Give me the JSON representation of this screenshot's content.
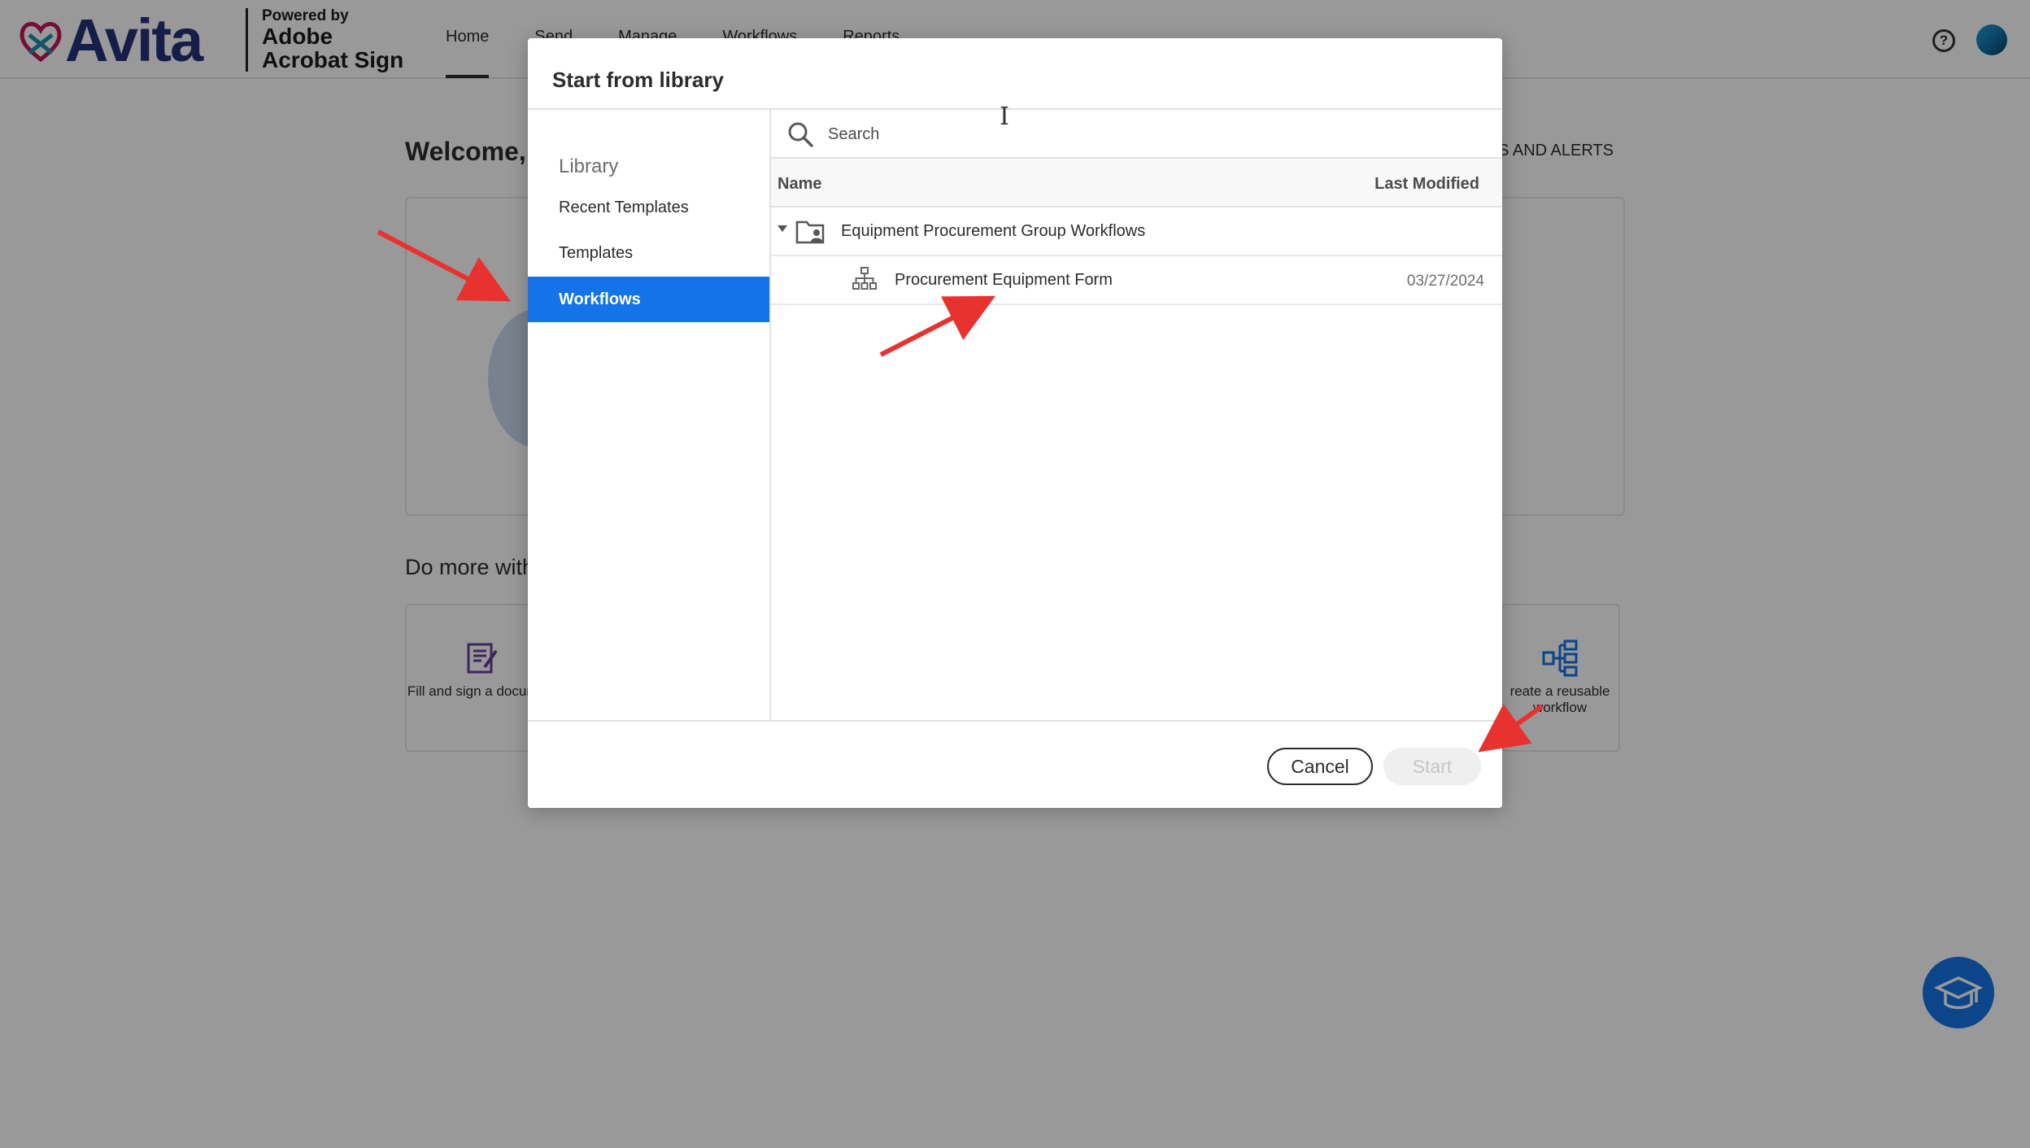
{
  "app": {
    "brand_name": "Avita",
    "powered_line1": "Powered by",
    "powered_line2": "Adobe",
    "powered_line3": "Acrobat Sign",
    "nav": [
      "Home",
      "Send",
      "Manage",
      "Workflows",
      "Reports"
    ],
    "active_nav": "Home",
    "help_icon_glyph": "?",
    "welcome": "Welcome, I",
    "alerts_link": "TS AND ALERTS",
    "do_more": "Do more with",
    "task_fill_sign": "Fill and sign a document",
    "task_reusable": "reate a reusable workflow",
    "accent_color": "#1473e6"
  },
  "modal": {
    "title": "Start from library",
    "sidebar": {
      "heading": "Library",
      "items": [
        "Recent Templates",
        "Templates",
        "Workflows"
      ],
      "selected": "Workflows"
    },
    "search": {
      "placeholder": "Search"
    },
    "table": {
      "columns": [
        "Name",
        "Last Modified"
      ],
      "rows": [
        {
          "type": "folder",
          "name": "Equipment Procurement Group Workflows",
          "last_modified": ""
        },
        {
          "type": "workflow",
          "name": "Procurement Equipment Form",
          "last_modified": "03/27/2024"
        }
      ]
    },
    "buttons": {
      "cancel": "Cancel",
      "start": "Start"
    }
  },
  "icons": [
    "search-icon",
    "folder-shared-icon",
    "workflow-hierarchy-icon",
    "help-icon",
    "fill-sign-icon",
    "workflow-builder-icon",
    "graduation-cap-icon",
    "text-cursor-icon",
    "caret-down-icon"
  ],
  "annotation_color": "#e8322f"
}
